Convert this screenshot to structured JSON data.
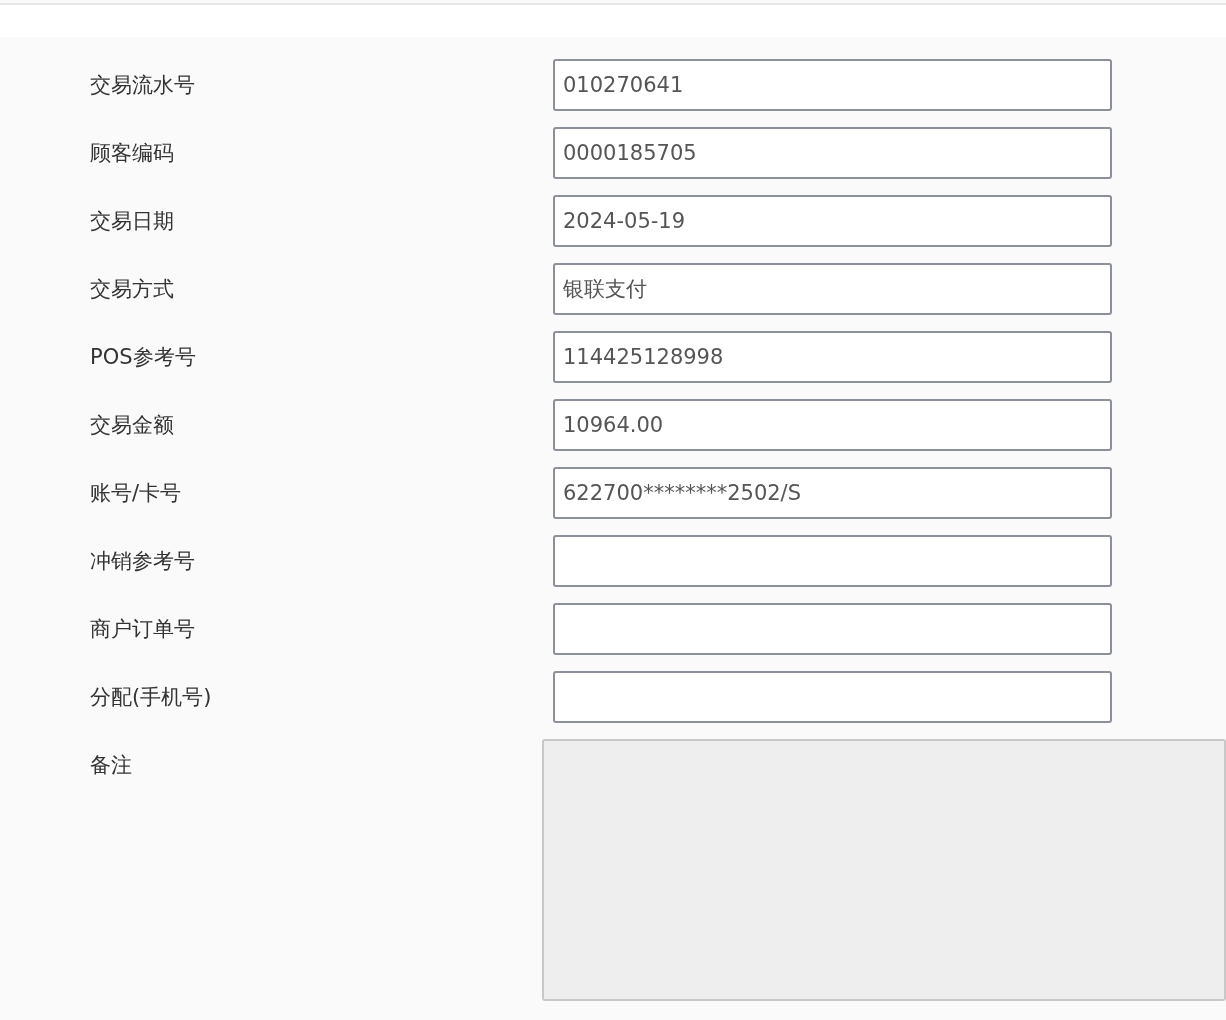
{
  "fields": [
    {
      "kind": "input",
      "label": "交易流水号",
      "value": "010270641",
      "disabled": false
    },
    {
      "kind": "input",
      "label": "顾客编码",
      "value": "0000185705",
      "disabled": false
    },
    {
      "kind": "input",
      "label": "交易日期",
      "value": "2024-05-19",
      "disabled": false
    },
    {
      "kind": "input",
      "label": "交易方式",
      "value": "银联支付",
      "disabled": false
    },
    {
      "kind": "input",
      "label": "POS参考号",
      "value": "114425128998",
      "disabled": false
    },
    {
      "kind": "input",
      "label": "交易金额",
      "value": "10964.00",
      "disabled": false
    },
    {
      "kind": "input",
      "label": "账号/卡号",
      "value": "622700********2502/S",
      "disabled": false
    },
    {
      "kind": "input",
      "label": "冲销参考号",
      "disabled": false
    },
    {
      "kind": "input",
      "label": "商户订单号",
      "disabled": false
    },
    {
      "kind": "input",
      "label": "分配(手机号)",
      "disabled": false
    },
    {
      "kind": "textarea",
      "label": "备注",
      "disabled": true
    }
  ]
}
